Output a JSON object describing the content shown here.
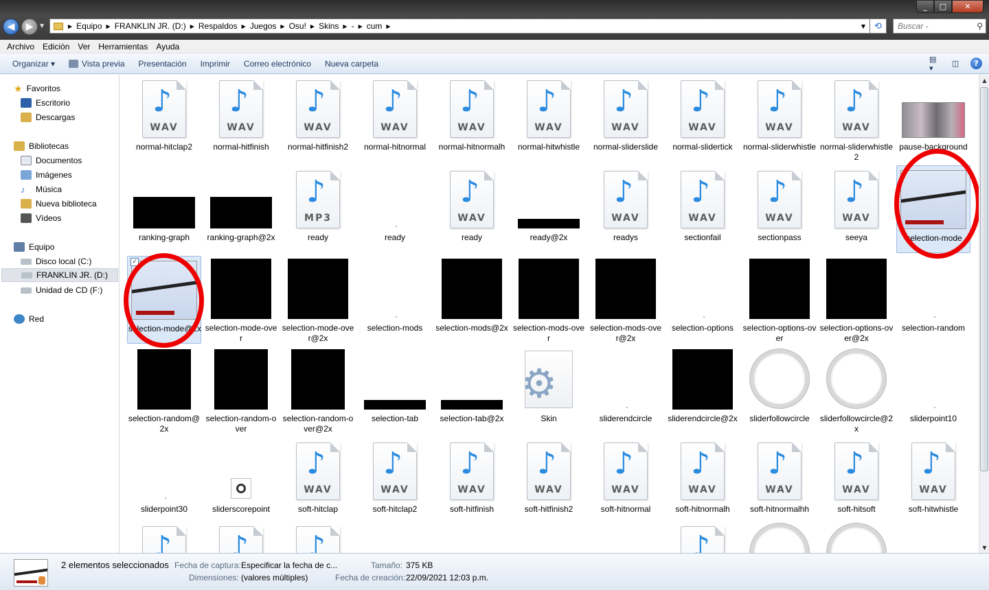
{
  "window": {
    "min_glyph": "_",
    "max_glyph": "□",
    "close_glyph": "✕"
  },
  "address": {
    "crumbs": [
      "Equipo",
      "FRANKLIN JR. (D:)",
      "Respaldos",
      "Juegos",
      "Osu!",
      "Skins",
      "-",
      "cum"
    ],
    "search_placeholder": "Buscar -"
  },
  "menu": [
    "Archivo",
    "Edición",
    "Ver",
    "Herramientas",
    "Ayuda"
  ],
  "commands": [
    "Organizar ▾",
    "Vista previa",
    "Presentación",
    "Imprimir",
    "Correo electrónico",
    "Nueva carpeta"
  ],
  "nav": {
    "favorites": {
      "label": "Favoritos",
      "items": [
        "Escritorio",
        "Descargas"
      ]
    },
    "libraries": {
      "label": "Bibliotecas",
      "items": [
        "Documentos",
        "Imágenes",
        "Música",
        "Nueva biblioteca",
        "Vídeos"
      ]
    },
    "computer": {
      "label": "Equipo",
      "items": [
        "Disco local (C:)",
        "FRANKLIN JR. (D:)",
        "Unidad de CD (F:)"
      ]
    },
    "network": {
      "label": "Red"
    }
  },
  "files": [
    {
      "name": "normal-hitclap2",
      "kind": "audio",
      "ext": "WAV"
    },
    {
      "name": "normal-hitfinish",
      "kind": "audio",
      "ext": "WAV"
    },
    {
      "name": "normal-hitfinish2",
      "kind": "audio",
      "ext": "WAV"
    },
    {
      "name": "normal-hitnormal",
      "kind": "audio",
      "ext": "WAV"
    },
    {
      "name": "normal-hitnormalh",
      "kind": "audio",
      "ext": "WAV"
    },
    {
      "name": "normal-hitwhistle",
      "kind": "audio",
      "ext": "WAV"
    },
    {
      "name": "normal-sliderslide",
      "kind": "audio",
      "ext": "WAV"
    },
    {
      "name": "normal-slidertick",
      "kind": "audio",
      "ext": "WAV"
    },
    {
      "name": "normal-sliderwhistle",
      "kind": "audio",
      "ext": "WAV"
    },
    {
      "name": "normal-sliderwhistle2",
      "kind": "audio",
      "ext": "WAV"
    },
    {
      "name": "pause-background",
      "kind": "photo"
    },
    {
      "name": "ranking-graph",
      "kind": "black-wide"
    },
    {
      "name": "ranking-graph@2x",
      "kind": "black-wide"
    },
    {
      "name": "ready",
      "kind": "audio",
      "ext": "MP3"
    },
    {
      "name": "ready",
      "kind": "blank"
    },
    {
      "name": "ready",
      "kind": "audio",
      "ext": "WAV"
    },
    {
      "name": "ready@2x",
      "kind": "black-strip"
    },
    {
      "name": "readys",
      "kind": "audio",
      "ext": "WAV"
    },
    {
      "name": "sectionfail",
      "kind": "audio",
      "ext": "WAV"
    },
    {
      "name": "sectionpass",
      "kind": "audio",
      "ext": "WAV"
    },
    {
      "name": "seeya",
      "kind": "audio",
      "ext": "WAV"
    },
    {
      "name": "selection-mode",
      "kind": "shot",
      "selected": true
    },
    {
      "name": "selection-mode@2x",
      "kind": "shot",
      "selected": true,
      "checked": true
    },
    {
      "name": "selection-mode-over",
      "kind": "black-square"
    },
    {
      "name": "selection-mode-over@2x",
      "kind": "black-square"
    },
    {
      "name": "selection-mods",
      "kind": "blank"
    },
    {
      "name": "selection-mods@2x",
      "kind": "black-square"
    },
    {
      "name": "selection-mods-over",
      "kind": "black-square"
    },
    {
      "name": "selection-mods-over@2x",
      "kind": "black-square"
    },
    {
      "name": "selection-options",
      "kind": "blank"
    },
    {
      "name": "selection-options-over",
      "kind": "black-square"
    },
    {
      "name": "selection-options-over@2x",
      "kind": "black-square"
    },
    {
      "name": "selection-random",
      "kind": "blank"
    },
    {
      "name": "selection-random@2x",
      "kind": "black-tall"
    },
    {
      "name": "selection-random-over",
      "kind": "black-tall"
    },
    {
      "name": "selection-random-over@2x",
      "kind": "black-tall"
    },
    {
      "name": "selection-tab",
      "kind": "black-strip"
    },
    {
      "name": "selection-tab@2x",
      "kind": "black-strip"
    },
    {
      "name": "Skin",
      "kind": "config"
    },
    {
      "name": "sliderendcircle",
      "kind": "blank"
    },
    {
      "name": "sliderendcircle@2x",
      "kind": "black-square"
    },
    {
      "name": "sliderfollowcircle",
      "kind": "ring"
    },
    {
      "name": "sliderfollowcircle@2x",
      "kind": "ring"
    },
    {
      "name": "sliderpoint10",
      "kind": "blank"
    },
    {
      "name": "sliderpoint30",
      "kind": "blank"
    },
    {
      "name": "sliderscorepoint",
      "kind": "dot"
    },
    {
      "name": "soft-hitclap",
      "kind": "audio",
      "ext": "WAV"
    },
    {
      "name": "soft-hitclap2",
      "kind": "audio",
      "ext": "WAV"
    },
    {
      "name": "soft-hitfinish",
      "kind": "audio",
      "ext": "WAV"
    },
    {
      "name": "soft-hitfinish2",
      "kind": "audio",
      "ext": "WAV"
    },
    {
      "name": "soft-hitnormal",
      "kind": "audio",
      "ext": "WAV"
    },
    {
      "name": "soft-hitnormalh",
      "kind": "audio",
      "ext": "WAV"
    },
    {
      "name": "soft-hitnormalhh",
      "kind": "audio",
      "ext": "WAV"
    },
    {
      "name": "soft-hitsoft",
      "kind": "audio",
      "ext": "WAV"
    },
    {
      "name": "soft-hitwhistle",
      "kind": "audio",
      "ext": "WAV"
    },
    {
      "name": "",
      "kind": "audio",
      "ext": "WAV"
    },
    {
      "name": "",
      "kind": "audio",
      "ext": "WAV"
    },
    {
      "name": "",
      "kind": "audio",
      "ext": "WAV"
    },
    {
      "name": "",
      "kind": "none"
    },
    {
      "name": "",
      "kind": "none"
    },
    {
      "name": "",
      "kind": "none"
    },
    {
      "name": "",
      "kind": "none"
    },
    {
      "name": "",
      "kind": "audio",
      "ext": "WAV"
    },
    {
      "name": "",
      "kind": "ring"
    },
    {
      "name": "",
      "kind": "ring"
    },
    {
      "name": "",
      "kind": "none"
    }
  ],
  "details": {
    "summary": "2 elementos seleccionados",
    "capture_label": "Fecha de captura:",
    "capture_value": "Especificar la fecha de c...",
    "size_label": "Tamaño:",
    "size_value": "375 KB",
    "dims_label": "Dimensiones:",
    "dims_value": "(valores múltiples)",
    "created_label": "Fecha de creación:",
    "created_value": "22/09/2021 12:03 p.m."
  },
  "colors": {
    "accent": "#1e395b",
    "selection": "#dbe8f8",
    "annotation": "#ee0000"
  }
}
